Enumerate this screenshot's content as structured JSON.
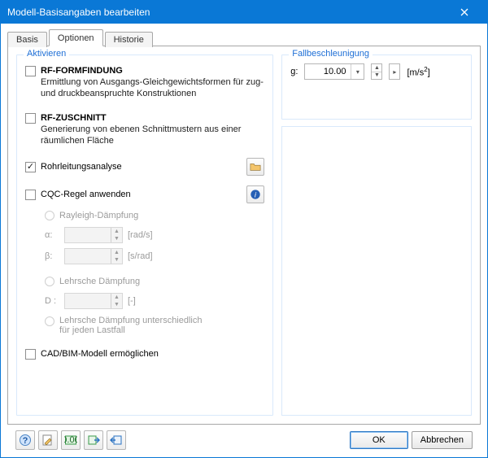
{
  "window": {
    "title": "Modell-Basisangaben bearbeiten"
  },
  "tabs": {
    "basis": "Basis",
    "optionen": "Optionen",
    "historie": "Historie"
  },
  "left": {
    "group_title": "Aktivieren",
    "formfindung": {
      "label": "RF-FORMFINDUNG",
      "desc": "Ermittlung von Ausgangs-Gleichgewichtsformen für zug- und druckbeanspruchte Konstruktionen"
    },
    "zuschnitt": {
      "label": "RF-ZUSCHNITT",
      "desc": "Generierung von ebenen Schnittmustern aus einer räumlichen Fläche"
    },
    "rohr": {
      "label": "Rohrleitungsanalyse"
    },
    "cqc": {
      "label": "CQC-Regel anwenden"
    },
    "rayleigh": {
      "label": "Rayleigh-Dämpfung"
    },
    "alpha": {
      "label": "α:",
      "value": "",
      "unit": "[rad/s]"
    },
    "beta": {
      "label": "β:",
      "value": "",
      "unit": "[s/rad]"
    },
    "lehr": {
      "label": "Lehrsche Dämpfung"
    },
    "d": {
      "label": "D :",
      "value": "",
      "unit": "[-]"
    },
    "lehr_per_lc": {
      "label": "Lehrsche Dämpfung unterschiedlich für jeden Lastfall"
    },
    "cadbim": {
      "label": "CAD/BIM-Modell ermöglichen"
    }
  },
  "right": {
    "group_title": "Fallbeschleunigung",
    "g_label": "g:",
    "g_value": "10.00",
    "g_unit_prefix": "[m/s",
    "g_unit_sup": "2",
    "g_unit_suffix": "]"
  },
  "footer": {
    "ok": "OK",
    "cancel": "Abbrechen"
  }
}
